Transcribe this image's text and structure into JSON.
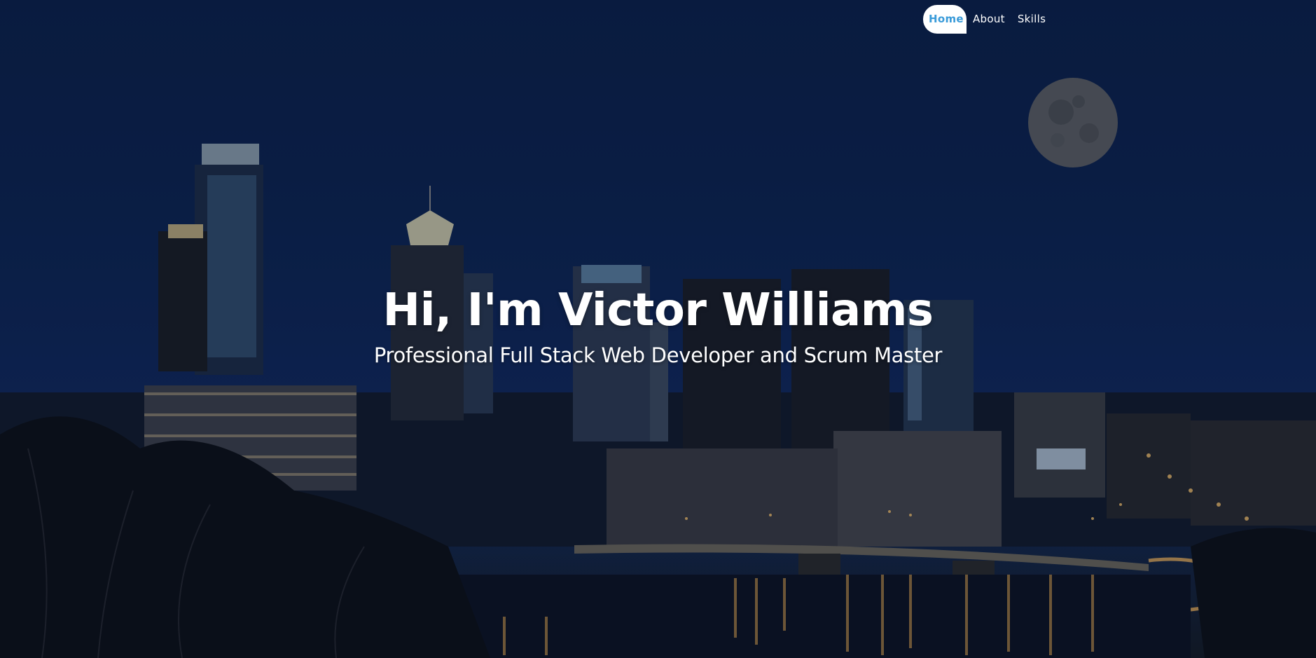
{
  "nav": {
    "items": [
      {
        "label": "Home",
        "active": true
      },
      {
        "label": "About",
        "active": false
      },
      {
        "label": "Skills",
        "active": false
      }
    ]
  },
  "hero": {
    "title": "Hi, I'm Victor Williams",
    "subtitle": "Professional Full Stack Web Developer and Scrum Master",
    "background": "night city skyline with river and full moon"
  },
  "colors": {
    "sky": "#0d234f",
    "active_nav_bg": "#ffffff",
    "active_nav_text": "#3a9bd9",
    "text": "#ffffff"
  }
}
